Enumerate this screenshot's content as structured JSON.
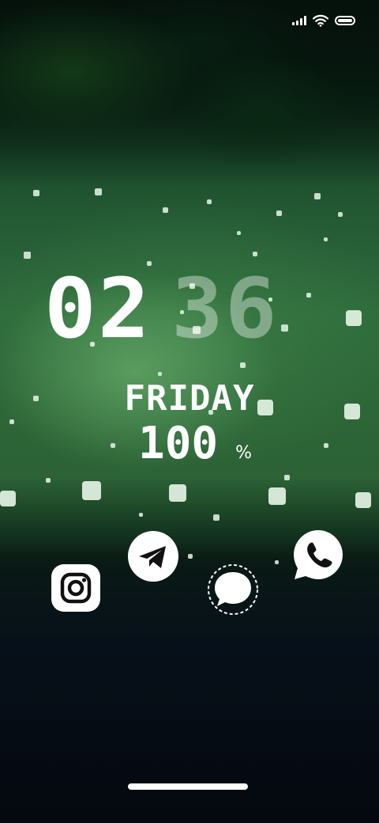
{
  "status_bar": {
    "signal_icon": "signal-bars-icon",
    "wifi_icon": "wifi-icon",
    "battery_icon": "battery-icon"
  },
  "clock": {
    "hours": "02",
    "minutes": "36"
  },
  "date": {
    "day": "FRIDAY"
  },
  "battery": {
    "level": "100",
    "unit": "%"
  },
  "apps": [
    {
      "name": "Instagram",
      "icon": "instagram-icon"
    },
    {
      "name": "Telegram",
      "icon": "telegram-icon"
    },
    {
      "name": "Messages",
      "icon": "message-bubble-icon"
    },
    {
      "name": "WhatsApp",
      "icon": "whatsapp-icon"
    }
  ],
  "colors": {
    "text": "#ffffff",
    "minutes_dim": "rgba(255,255,255,0.38)",
    "background_green": "#2f6c3c"
  }
}
